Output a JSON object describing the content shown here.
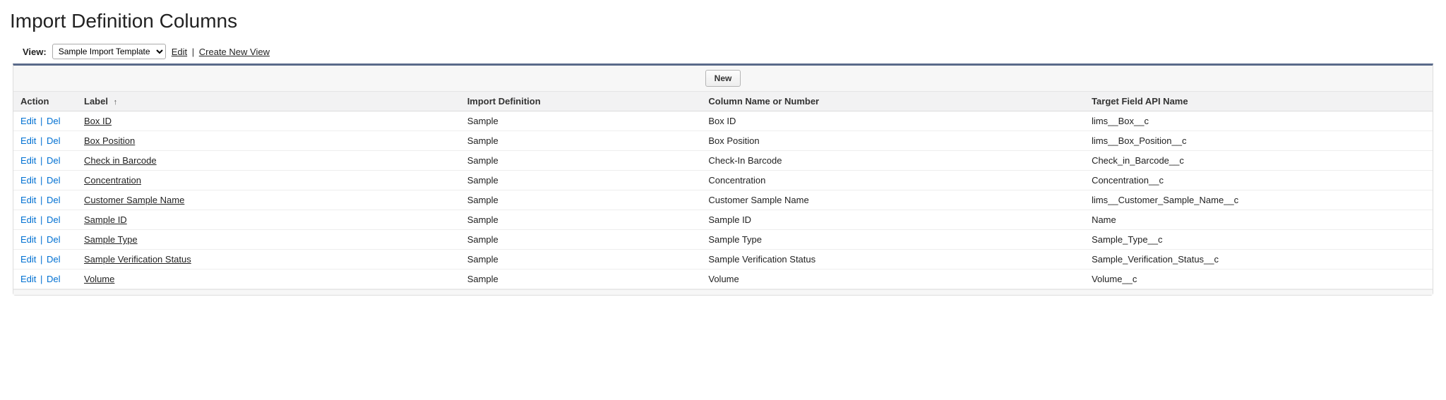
{
  "page": {
    "title": "Import Definition Columns"
  },
  "viewBar": {
    "viewLabel": "View:",
    "selectedView": "Sample Import Template",
    "editLabel": "Edit",
    "createNewLabel": "Create New View"
  },
  "buttons": {
    "newLabel": "New"
  },
  "table": {
    "headers": {
      "action": "Action",
      "label": "Label",
      "importDefinition": "Import Definition",
      "columnName": "Column Name or Number",
      "targetField": "Target Field API Name"
    },
    "sortAscIndicator": "↑",
    "actionEdit": "Edit",
    "actionDel": "Del",
    "rows": [
      {
        "label": "Box ID",
        "importDefinition": "Sample",
        "columnName": "Box ID",
        "targetField": "lims__Box__c"
      },
      {
        "label": "Box Position",
        "importDefinition": "Sample",
        "columnName": "Box Position",
        "targetField": "lims__Box_Position__c"
      },
      {
        "label": "Check in Barcode",
        "importDefinition": "Sample",
        "columnName": "Check-In Barcode",
        "targetField": "Check_in_Barcode__c"
      },
      {
        "label": "Concentration",
        "importDefinition": "Sample",
        "columnName": "Concentration",
        "targetField": "Concentration__c"
      },
      {
        "label": "Customer Sample Name",
        "importDefinition": "Sample",
        "columnName": "Customer Sample Name",
        "targetField": "lims__Customer_Sample_Name__c"
      },
      {
        "label": "Sample ID",
        "importDefinition": "Sample",
        "columnName": "Sample ID",
        "targetField": "Name"
      },
      {
        "label": "Sample Type",
        "importDefinition": "Sample",
        "columnName": "Sample Type",
        "targetField": "Sample_Type__c"
      },
      {
        "label": "Sample Verification Status",
        "importDefinition": "Sample",
        "columnName": "Sample Verification Status",
        "targetField": "Sample_Verification_Status__c"
      },
      {
        "label": "Volume",
        "importDefinition": "Sample",
        "columnName": "Volume",
        "targetField": "Volume__c"
      }
    ]
  }
}
